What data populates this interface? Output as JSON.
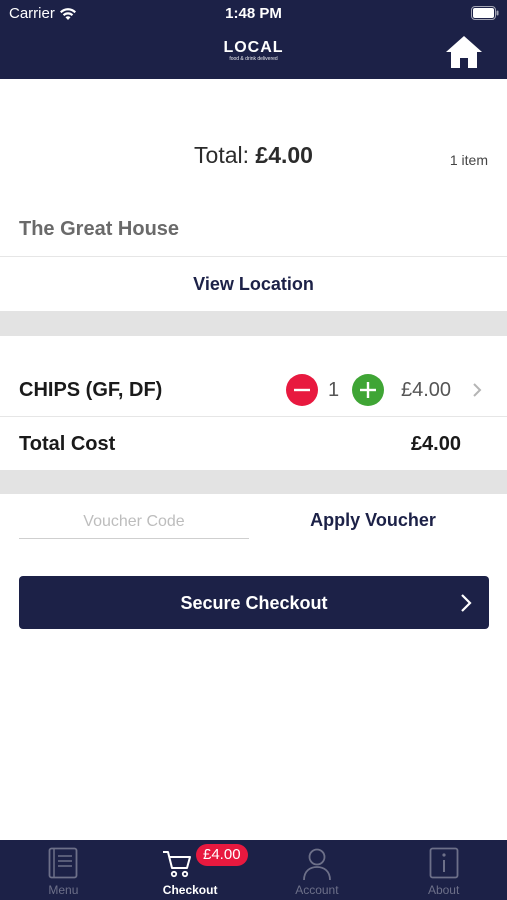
{
  "status_bar": {
    "carrier": "Carrier",
    "time": "1:48 PM"
  },
  "header": {
    "logo": "LOCAL",
    "tagline": "food & drink delivered",
    "home_icon": "home-icon"
  },
  "summary": {
    "total_label": "Total:",
    "total_value": "£4.00",
    "item_count": "1 item"
  },
  "venue": {
    "name": "The Great House",
    "view_location_label": "View Location"
  },
  "basket": {
    "items": [
      {
        "name": "CHIPS (GF, DF)",
        "quantity": "1",
        "price": "£4.00"
      }
    ],
    "total_cost_label": "Total Cost",
    "total_cost_value": "£4.00"
  },
  "voucher": {
    "placeholder": "Voucher Code",
    "value": "",
    "apply_label": "Apply Voucher"
  },
  "checkout": {
    "label": "Secure Checkout"
  },
  "tabs": [
    {
      "label": "Menu",
      "icon": "menu-book-icon"
    },
    {
      "label": "Checkout",
      "icon": "cart-icon",
      "badge": "£4.00",
      "active": true
    },
    {
      "label": "Account",
      "icon": "user-icon"
    },
    {
      "label": "About",
      "icon": "info-icon"
    }
  ],
  "colors": {
    "brand": "#1c2147",
    "minus": "#e8193f",
    "plus": "#3fa535",
    "badge": "#e8193f"
  }
}
